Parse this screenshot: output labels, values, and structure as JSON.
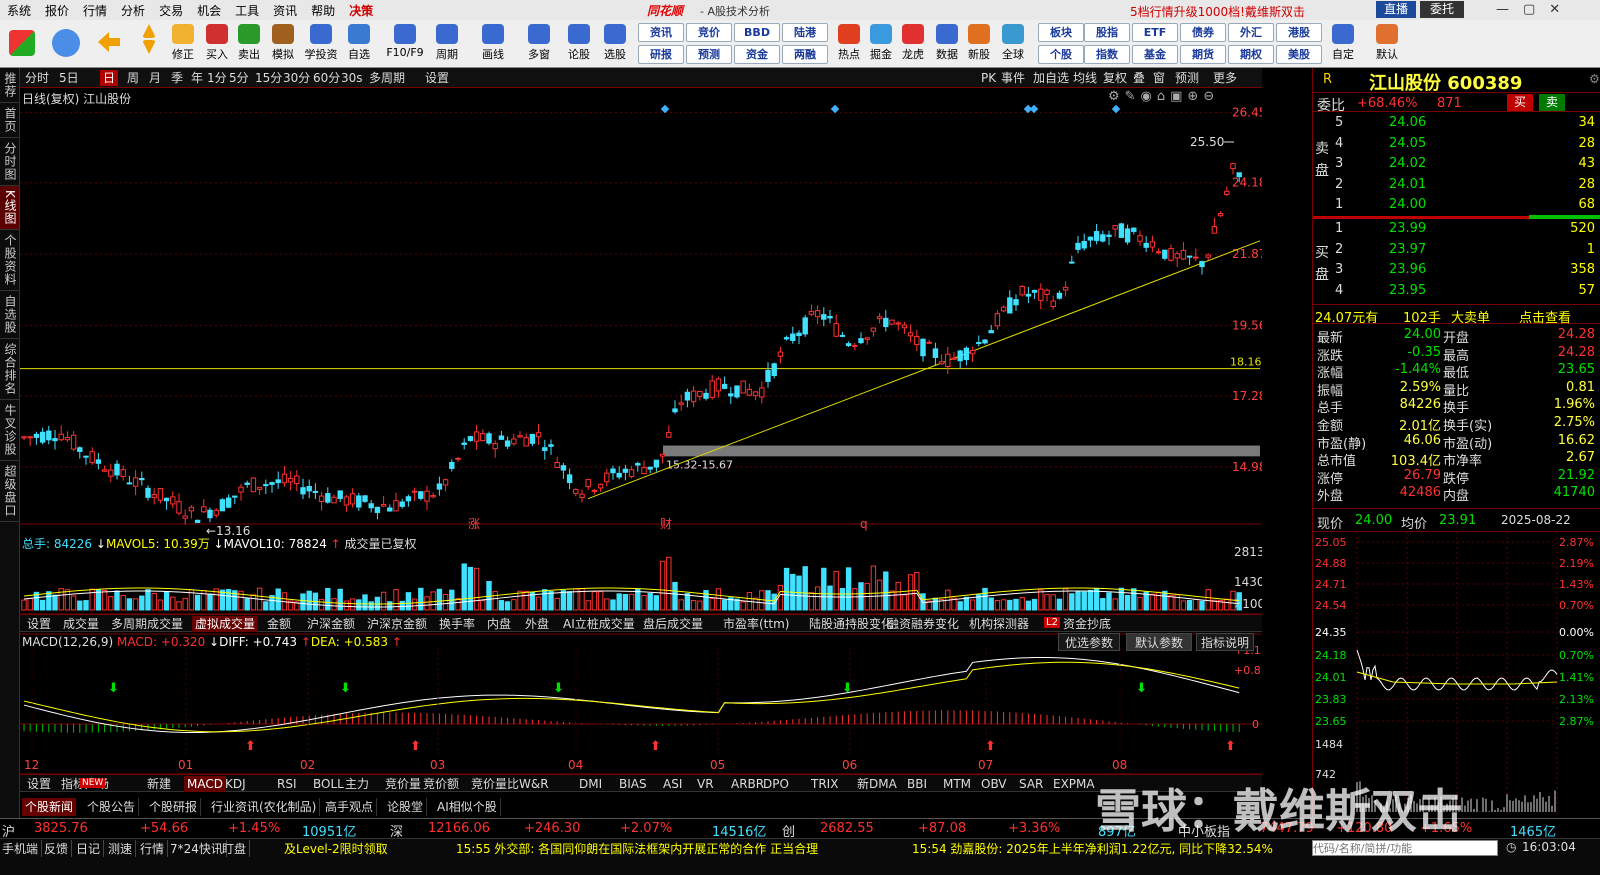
{
  "menu": {
    "items": [
      "系统",
      "报价",
      "行情",
      "分析",
      "交易",
      "机会",
      "工具",
      "资讯",
      "帮助",
      "决策"
    ],
    "brand": "同花顺",
    "title": "- A股技术分析",
    "promo": "5档行情升级1000档!",
    "promo2": "戴维斯双击",
    "right_buttons": [
      "直播",
      "委托"
    ]
  },
  "toolbar": {
    "buttons": [
      "修正",
      "买入",
      "卖出",
      "模拟",
      "学投资",
      "自选",
      "F10/F9",
      "周期",
      "画线",
      "多窗",
      "论股",
      "选股",
      "热点",
      "掘金",
      "龙虎",
      "数据",
      "新股",
      "全球",
      "自定",
      "默认"
    ],
    "pills_top": [
      "资讯",
      "竞价",
      "BBD",
      "陆港",
      "板块",
      "股指",
      "ETF",
      "债券",
      "外汇",
      "港股"
    ],
    "pills_bottom": [
      "研报",
      "预测",
      "资金",
      "两融",
      "个股",
      "指数",
      "基金",
      "期货",
      "期权",
      "美股"
    ]
  },
  "leftnav": [
    "推荐",
    "首页",
    "分时图",
    "K线图",
    "个股资料",
    "自选股",
    "综合排名",
    "牛叉诊股",
    "超级盘口"
  ],
  "chartbar": {
    "periods": [
      "分时",
      "5日",
      "日",
      "周",
      "月",
      "季",
      "年",
      "1分",
      "5分",
      "15分",
      "30分",
      "60分",
      "30s",
      "多周期",
      "设置"
    ],
    "selected": "日",
    "right": [
      "PK",
      "事件",
      "加自选",
      "均线",
      "复权",
      "叠",
      "窗",
      "预测",
      "更多"
    ]
  },
  "kline": {
    "label": "日线(复权)  江山股份",
    "price_axis": [
      "26.45",
      "24.18",
      "21.87",
      "19.56",
      "17.28",
      "14.98"
    ],
    "high_label": "25.50",
    "low_label": "13.16",
    "hline_label": "18.16",
    "zone_label": "15.32-15.67",
    "markers": [
      "涨",
      "财",
      "q"
    ]
  },
  "volume": {
    "total_label": "总手: 84226",
    "mavol5": "MAVOL5: 10.39万",
    "mavol10": "MAVOL10: 78824",
    "note": "成交量已复权",
    "axis": [
      "2813",
      "1430",
      "X100"
    ]
  },
  "vtabs": [
    "设置",
    "成交量",
    "多周期成交量",
    "虚拟成交量",
    "金额",
    "沪深金额",
    "沪深京金额",
    "换手率",
    "内盘",
    "外盘",
    "AI立桩成交量",
    "盘后成交量",
    "市盈率(ttm)",
    "陆股通持股变化",
    "融资融券变化",
    "机构探测器",
    "资金抄底"
  ],
  "macd": {
    "label": "MACD(12,26,9)",
    "macd": "MACD: +0.320",
    "diff": "DIFF: +0.743",
    "dea": "DEA: +0.583",
    "axis": [
      "+1.11",
      "+0.814",
      "0"
    ],
    "buttons": [
      "优选参数",
      "默认参数",
      "指标说明"
    ],
    "months": [
      "12",
      "01",
      "02",
      "03",
      "04",
      "05",
      "06",
      "07",
      "08"
    ]
  },
  "itabs": [
    "设置",
    "指标广场",
    "新建",
    "MACD",
    "KDJ",
    "RSI",
    "BOLL",
    "主力",
    "竞价量",
    "竞价额",
    "竞价量比",
    "W&R",
    "DMI",
    "BIAS",
    "ASI",
    "VR",
    "ARBR",
    "DPO",
    "TRIX",
    "新DMA",
    "BBI",
    "MTM",
    "OBV",
    "SAR",
    "EXPMA"
  ],
  "newstabs": [
    "个股新闻",
    "个股公告",
    "个股研报",
    "行业资讯(农化制品)",
    "高手观点",
    "论股堂",
    "AI相似个股"
  ],
  "quote": {
    "name": "江山股份",
    "code": "600389",
    "weibi": "委比",
    "weibi_val": "+68.46%",
    "weicha": "871",
    "buy": "买",
    "sell": "卖",
    "sell_side": "卖盘",
    "buy_side": "买盘",
    "asks": [
      [
        "5",
        "24.06",
        "34"
      ],
      [
        "4",
        "24.05",
        "28"
      ],
      [
        "3",
        "24.02",
        "43"
      ],
      [
        "2",
        "24.01",
        "28"
      ],
      [
        "1",
        "24.00",
        "68"
      ]
    ],
    "bids": [
      [
        "1",
        "23.99",
        "520"
      ],
      [
        "2",
        "23.97",
        "1"
      ],
      [
        "3",
        "23.96",
        "358"
      ],
      [
        "4",
        "23.95",
        "57"
      ]
    ],
    "bigorder": [
      "24.07元有",
      "102手",
      "大卖单",
      "点击查看"
    ],
    "stats": [
      [
        "最新",
        "24.00",
        "开盘",
        "24.28"
      ],
      [
        "涨跌",
        "-0.35",
        "最高",
        "24.28"
      ],
      [
        "涨幅",
        "-1.44%",
        "最低",
        "23.65"
      ],
      [
        "振幅",
        "2.59%",
        "量比",
        "0.81"
      ],
      [
        "总手",
        "84226",
        "换手",
        "1.96%"
      ],
      [
        "金额",
        "2.01亿",
        "换手(实)",
        "2.75%"
      ],
      [
        "市盈(静)",
        "46.06",
        "市盈(动)",
        "16.62"
      ],
      [
        "总市值",
        "103.4亿",
        "市净率",
        "2.67"
      ],
      [
        "涨停",
        "26.79",
        "跌停",
        "21.92"
      ],
      [
        "外盘",
        "42486",
        "内盘",
        "41740"
      ]
    ],
    "now_label": "现价",
    "now": "24.00",
    "avg_label": "均价",
    "avg": "23.91",
    "date": "2025-08-22",
    "intraday_left": [
      "25.05",
      "24.88",
      "24.71",
      "24.54",
      "24.35",
      "24.18",
      "24.01",
      "23.83",
      "23.65",
      "1484",
      "742"
    ],
    "intraday_right": [
      "2.87%",
      "2.19%",
      "1.43%",
      "0.70%",
      "0.00%",
      "0.70%",
      "1.41%",
      "2.13%",
      "2.87%"
    ]
  },
  "indices": [
    [
      "沪",
      "3825.76",
      "+54.66",
      "+1.45%",
      "10951亿"
    ],
    [
      "深",
      "12166.06",
      "+246.30",
      "+2.07%",
      "14516亿"
    ],
    [
      "创",
      "2682.55",
      "+87.08",
      "+3.36%",
      "897亿"
    ],
    [
      "中小板指",
      "7447.79",
      "+120.80",
      "+1.65%",
      "1465亿"
    ]
  ],
  "bottom": {
    "items": [
      "手机端",
      "反馈",
      "日记",
      "测速",
      "行情",
      "7*24快讯",
      "盯盘"
    ],
    "level2": "及Level-2限时领取",
    "news1": "15:55 外交部: 各国同仰朗在国际法框架内开展正常的合作 正当合理",
    "news2": "15:54 劲嘉股份: 2025年上半年净利润1.22亿元, 同比下降32.54%",
    "search": "代码/名称/简拼/功能",
    "time": "16:03:04"
  },
  "watermark": "雪球：戴维斯双击",
  "chart_data": {
    "type": "candlestick",
    "price_ylim": [
      13.0,
      26.6
    ],
    "hline": 18.16,
    "zone": [
      15.32,
      15.67
    ],
    "high": 25.5,
    "low": 13.16
  }
}
